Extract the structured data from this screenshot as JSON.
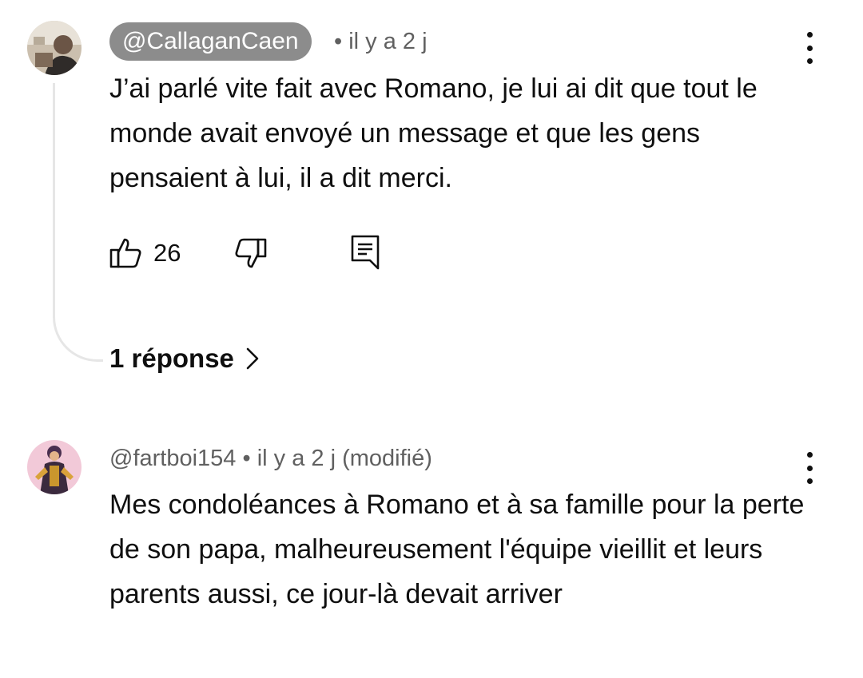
{
  "comments": [
    {
      "author": "@CallaganCaen",
      "meta": "• il y a 2 j",
      "text": "J’ai parlé vite fait avec Romano, je lui ai dit que tout le monde avait envoyé un message et que les gens pensaient à lui, il a dit merci.",
      "likes": "26",
      "replies_label": "1 réponse"
    },
    {
      "author": "@fartboi154",
      "meta": "• il y a 2 j (modifié)",
      "text": "Mes condoléances à Romano et à sa famille pour la perte de son papa, malheureusement l'équipe vieillit et leurs parents aussi, ce jour-là devait arriver"
    }
  ],
  "icons": {
    "like": "thumb-up-icon",
    "dislike": "thumb-down-icon",
    "reply": "comment-reply-icon",
    "more": "more-vertical-icon",
    "chevron": "chevron-right-icon"
  },
  "colors": {
    "handle_pill": "#8c8c8c",
    "meta_text": "#606060",
    "thread_line": "#e6e6e6"
  }
}
